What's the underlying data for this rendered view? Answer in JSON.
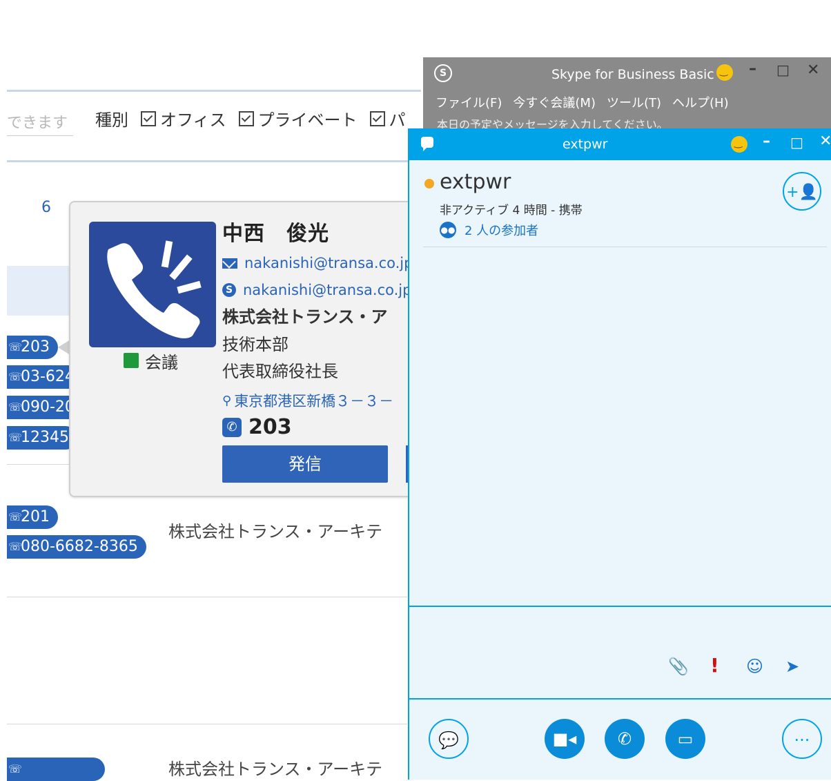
{
  "background": {
    "search_hint": "できます",
    "filter_label": "種別",
    "filter_options": [
      "オフィス",
      "プライベート",
      "パ"
    ],
    "row_number": "6",
    "phone_pills_row1": [
      "203",
      "03-624",
      "090-20",
      "12345"
    ],
    "phone_pills_row2": [
      "201",
      "080-6682-8365"
    ],
    "company_row2": "株式会社トランス・アーキテ",
    "company_row3": "株式会社トランス・アーキテ"
  },
  "contact_card": {
    "name": "中西　俊光",
    "email": "nakanishi@transa.co.jp",
    "skype": "nakanishi@transa.co.jp",
    "company": "株式会社トランス・ア",
    "department": "技術本部",
    "title": "代表取締役社長",
    "address": "東京都港区新橋３－３－",
    "extension": "203",
    "presence": "会議",
    "dial_button": "発信"
  },
  "skype_main": {
    "title": "Skype for Business Basic",
    "menu": [
      "ファイル(F)",
      "今すぐ会議(M)",
      "ツール(T)",
      "ヘルプ(H)"
    ],
    "status_placeholder": "本日の予定やメッセージを入力してください。"
  },
  "conversation": {
    "title": "extpwr",
    "contact_name": "extpwr",
    "status": "非アクティブ 4 時間 - 携帯",
    "participants": "2 人の参加者"
  },
  "colors": {
    "skype_blue": "#00a2e8",
    "app_blue": "#2a64b8",
    "presence_green": "#1e9a3a",
    "away_yellow": "#f5a623"
  }
}
